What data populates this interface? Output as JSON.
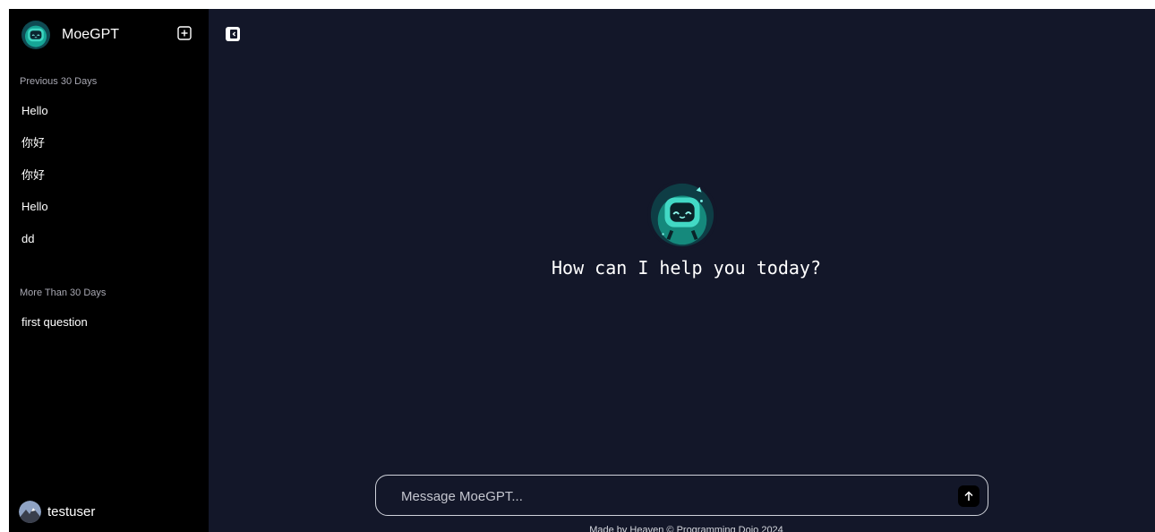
{
  "brand": {
    "name": "MoeGPT",
    "logo_icon": "robot-mascot-icon"
  },
  "sidebar": {
    "new_chat_icon": "plus-square-icon",
    "sections": [
      {
        "label": "Previous 30 Days",
        "items": [
          "Hello",
          "你好",
          "你好",
          "Hello",
          "dd"
        ]
      },
      {
        "label": "More Than 30 Days",
        "items": [
          "first question"
        ]
      }
    ],
    "user": {
      "name": "testuser",
      "avatar_icon": "mountain-avatar-icon"
    }
  },
  "main": {
    "toggle_icon": "sidebar-toggle-icon",
    "greeting": "How can I help you today?",
    "composer": {
      "placeholder": "Message MoeGPT...",
      "send_icon": "arrow-up-icon"
    },
    "footer": "Made by Heaven © Programming Dojo 2024"
  },
  "colors": {
    "sidebar_bg": "#000000",
    "main_bg": "#131729",
    "text": "#ffffff",
    "accent_teal": "#2bb3a3"
  }
}
